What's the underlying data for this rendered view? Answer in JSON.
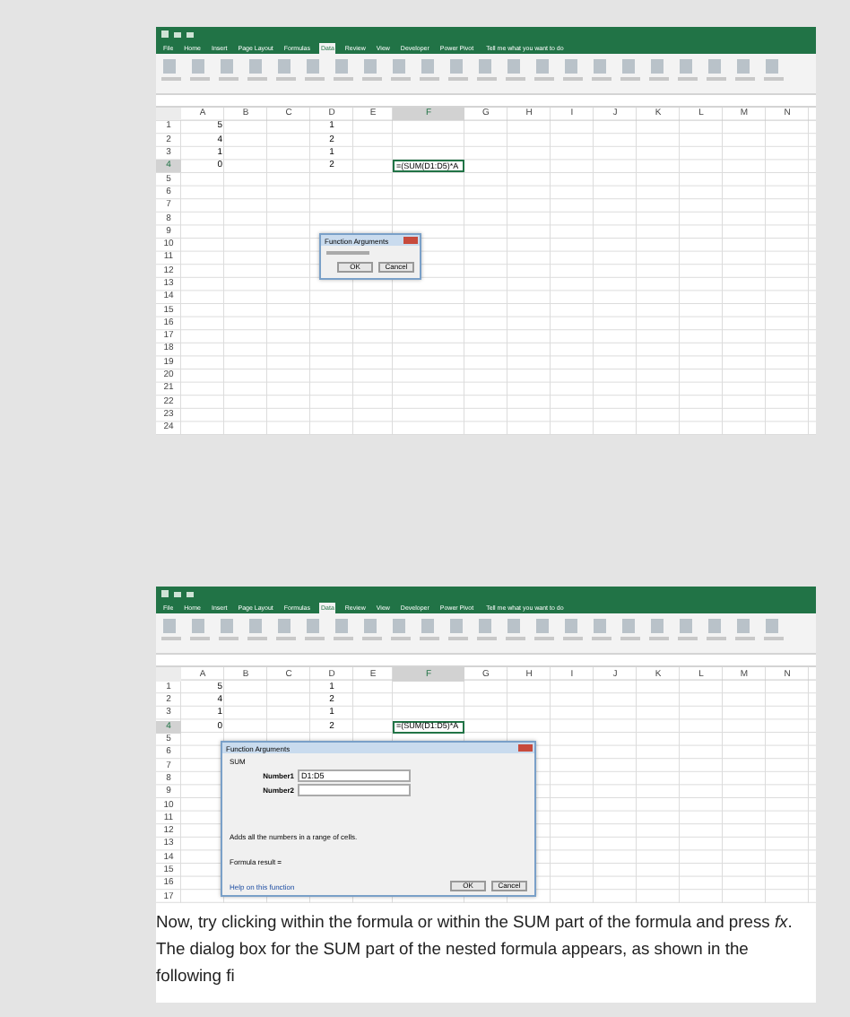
{
  "screenshots": [
    {
      "tabs": [
        {
          "label": "File",
          "selected": false
        },
        {
          "label": "Home",
          "selected": false
        },
        {
          "label": "Insert",
          "selected": false
        },
        {
          "label": "Page Layout",
          "selected": false
        },
        {
          "label": "Formulas",
          "selected": false
        },
        {
          "label": "Data",
          "selected": true
        },
        {
          "label": "Review",
          "selected": false
        },
        {
          "label": "View",
          "selected": false
        },
        {
          "label": "Developer",
          "selected": false
        },
        {
          "label": "Power Pivot",
          "selected": false
        }
      ],
      "tell_me": "Tell me what you want to do",
      "columns": [
        {
          "label": "A",
          "selected": false
        },
        {
          "label": "B",
          "selected": false
        },
        {
          "label": "C",
          "selected": false
        },
        {
          "label": "D",
          "selected": false
        },
        {
          "label": "E",
          "selected": false
        },
        {
          "label": "F",
          "selected": true
        },
        {
          "label": "G",
          "selected": false
        },
        {
          "label": "H",
          "selected": false
        },
        {
          "label": "I",
          "selected": false
        },
        {
          "label": "J",
          "selected": false
        },
        {
          "label": "K",
          "selected": false
        },
        {
          "label": "L",
          "selected": false
        },
        {
          "label": "M",
          "selected": false
        },
        {
          "label": "N",
          "selected": false
        }
      ],
      "rows": [
        {
          "number": "1",
          "selected": false,
          "cells": [
            "5",
            null,
            null,
            "1"
          ]
        },
        {
          "number": "2",
          "selected": false,
          "cells": [
            "4",
            null,
            null,
            "2"
          ]
        },
        {
          "number": "3",
          "selected": false,
          "cells": [
            "1",
            null,
            null,
            "1"
          ]
        },
        {
          "number": "4",
          "selected": true,
          "cells": [
            "0",
            null,
            null,
            "2",
            null,
            "=(SUM(D1:D5)*A"
          ]
        },
        {
          "number": "5",
          "selected": false
        },
        {
          "number": "6",
          "selected": false
        },
        {
          "number": "7",
          "selected": false
        },
        {
          "number": "8",
          "selected": false
        },
        {
          "number": "9",
          "selected": false
        },
        {
          "number": "10",
          "selected": false
        },
        {
          "number": "11",
          "selected": false
        },
        {
          "number": "12",
          "selected": false
        },
        {
          "number": "13",
          "selected": false
        },
        {
          "number": "14",
          "selected": false
        },
        {
          "number": "15",
          "selected": false
        },
        {
          "number": "16",
          "selected": false
        },
        {
          "number": "17",
          "selected": false
        },
        {
          "number": "18",
          "selected": false
        },
        {
          "number": "19",
          "selected": false
        },
        {
          "number": "20",
          "selected": false
        },
        {
          "number": "21",
          "selected": false
        },
        {
          "number": "22",
          "selected": false
        },
        {
          "number": "23",
          "selected": false
        },
        {
          "number": "24",
          "selected": false
        }
      ],
      "dialog": {
        "kind": "small",
        "title": "Function Arguments",
        "buttons": [
          "OK",
          "Cancel"
        ]
      }
    },
    {
      "tabs": [
        {
          "label": "File",
          "selected": false
        },
        {
          "label": "Home",
          "selected": false
        },
        {
          "label": "Insert",
          "selected": false
        },
        {
          "label": "Page Layout",
          "selected": false
        },
        {
          "label": "Formulas",
          "selected": false
        },
        {
          "label": "Data",
          "selected": true
        },
        {
          "label": "Review",
          "selected": false
        },
        {
          "label": "View",
          "selected": false
        },
        {
          "label": "Developer",
          "selected": false
        },
        {
          "label": "Power Pivot",
          "selected": false
        }
      ],
      "tell_me": "Tell me what you want to do",
      "columns": [
        {
          "label": "A",
          "selected": false
        },
        {
          "label": "B",
          "selected": false
        },
        {
          "label": "C",
          "selected": false
        },
        {
          "label": "D",
          "selected": false
        },
        {
          "label": "E",
          "selected": false
        },
        {
          "label": "F",
          "selected": true
        },
        {
          "label": "G",
          "selected": false
        },
        {
          "label": "H",
          "selected": false
        },
        {
          "label": "I",
          "selected": false
        },
        {
          "label": "J",
          "selected": false
        },
        {
          "label": "K",
          "selected": false
        },
        {
          "label": "L",
          "selected": false
        },
        {
          "label": "M",
          "selected": false
        },
        {
          "label": "N",
          "selected": false
        }
      ],
      "rows": [
        {
          "number": "1",
          "selected": false,
          "cells": [
            "5",
            null,
            null,
            "1"
          ]
        },
        {
          "number": "2",
          "selected": false,
          "cells": [
            "4",
            null,
            null,
            "2"
          ]
        },
        {
          "number": "3",
          "selected": false,
          "cells": [
            "1",
            null,
            null,
            "1"
          ]
        },
        {
          "number": "4",
          "selected": true,
          "cells": [
            "0",
            null,
            null,
            "2",
            null,
            "=(SUM(D1:D5)*A"
          ]
        },
        {
          "number": "5",
          "selected": false
        },
        {
          "number": "6",
          "selected": false
        },
        {
          "number": "7",
          "selected": false
        },
        {
          "number": "8",
          "selected": false
        },
        {
          "number": "9",
          "selected": false
        },
        {
          "number": "10",
          "selected": false
        },
        {
          "number": "11",
          "selected": false
        },
        {
          "number": "12",
          "selected": false
        },
        {
          "number": "13",
          "selected": false
        },
        {
          "number": "14",
          "selected": false
        },
        {
          "number": "15",
          "selected": false
        },
        {
          "number": "16",
          "selected": false
        },
        {
          "number": "17",
          "selected": false
        }
      ],
      "dialog": {
        "kind": "full",
        "title": "Function Arguments",
        "function": "SUM",
        "arguments": [
          {
            "label": "Number1",
            "value": "D1:D5"
          },
          {
            "label": "Number2"
          }
        ],
        "description": "Adds all the numbers in a range of cells.",
        "result_label": "Formula result =",
        "help_link": "Help on this function",
        "buttons": [
          "OK",
          "Cancel"
        ]
      }
    }
  ],
  "paragraph": "Now, try clicking within the formula or within the SUM part of the formula and press *fx*. The dialog box for the SUM part of the nested formula appears, as shown in the following fi"
}
